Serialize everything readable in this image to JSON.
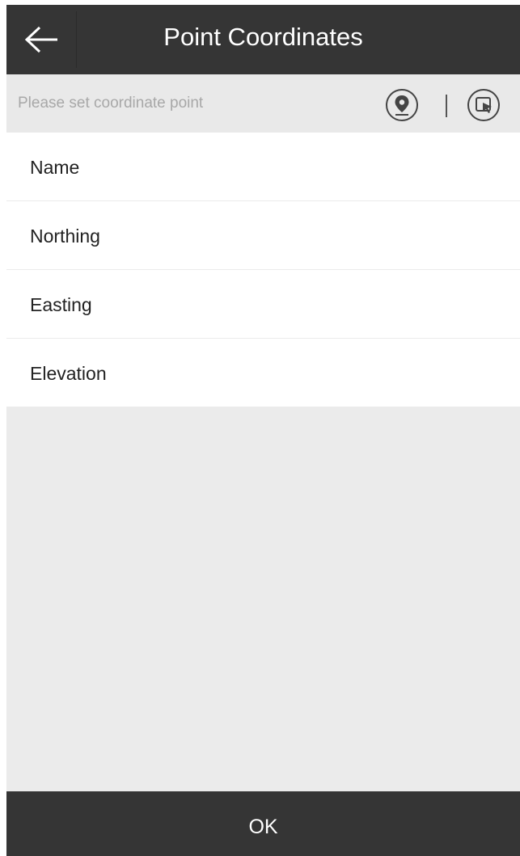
{
  "header": {
    "title": "Point Coordinates",
    "back_icon": "arrow-left-icon"
  },
  "coord_bar": {
    "placeholder": "Please set coordinate point",
    "pin_icon": "location-pin-icon",
    "select_icon": "select-on-map-icon"
  },
  "fields": [
    {
      "label": "Name",
      "value": ""
    },
    {
      "label": "Northing",
      "value": ""
    },
    {
      "label": "Easting",
      "value": ""
    },
    {
      "label": "Elevation",
      "value": ""
    }
  ],
  "footer": {
    "ok_label": "OK"
  },
  "colors": {
    "bar_dark": "#353535",
    "background": "#ebebeb",
    "row_background": "#ffffff",
    "placeholder_text": "#a8a8a8"
  }
}
